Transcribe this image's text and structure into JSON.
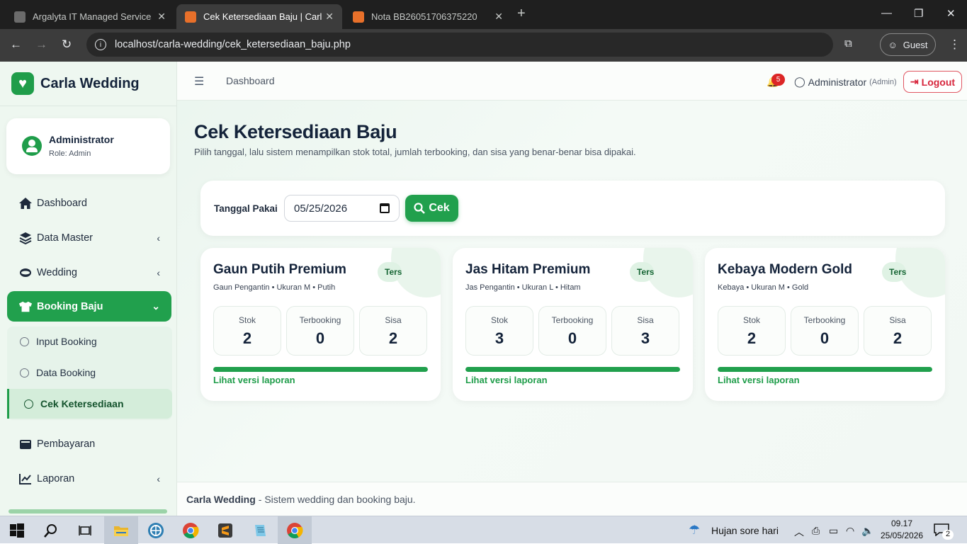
{
  "browser": {
    "tabs": [
      {
        "title": "Argalyta IT Managed Services &",
        "fav": "#5f6368"
      },
      {
        "title": "Cek Ketersediaan Baju | Carla W",
        "fav": "#e8702a"
      },
      {
        "title": "Nota BB26051706375220",
        "fav": "#e8702a"
      }
    ],
    "url": "localhost/carla-wedding/cek_ketersediaan_baju.php",
    "guest_label": "Guest"
  },
  "sidebar": {
    "brand": "Carla Wedding",
    "user_name": "Administrator",
    "user_role": "Role: Admin",
    "items": [
      {
        "label": "Dashboard",
        "icon": "home-icon"
      },
      {
        "label": "Data Master",
        "icon": "layers-icon"
      },
      {
        "label": "Wedding",
        "icon": "ring-icon"
      },
      {
        "label": "Booking Baju",
        "icon": "shirt-icon"
      },
      {
        "label": "Pembayaran",
        "icon": "wallet-icon"
      },
      {
        "label": "Laporan",
        "icon": "chart-line-icon"
      }
    ],
    "sub_items": [
      "Input Booking",
      "Data Booking",
      "Cek Ketersediaan"
    ]
  },
  "topbar": {
    "breadcrumb": "Dashboard",
    "notif_count": "5",
    "admin_name": "Administrator",
    "admin_role": "(Admin)",
    "logout_label": "Logout"
  },
  "page": {
    "title": "Cek Ketersediaan Baju",
    "subtitle": "Pilih tanggal, lalu sistem menampilkan stok total, jumlah terbooking, dan sisa yang benar-benar bisa dipakai."
  },
  "filter": {
    "label": "Tanggal Pakai",
    "date_value": "05/25/2026",
    "button_label": "Cek"
  },
  "cards": [
    {
      "title": "Gaun Putih Premium",
      "tag": "Tersedia",
      "meta": "Gaun Pengantin • Ukuran M • Putih",
      "stok": "2",
      "terbooking": "0",
      "sisa": "2",
      "availability": 1.0,
      "link": "Lihat versi laporan"
    },
    {
      "title": "Jas Hitam Premium",
      "tag": "Tersedia",
      "meta": "Jas Pengantin • Ukuran L • Hitam",
      "stok": "3",
      "terbooking": "0",
      "sisa": "3",
      "availability": 1.0,
      "link": "Lihat versi laporan"
    },
    {
      "title": "Kebaya Modern Gold",
      "tag": "Tersedia",
      "meta": "Kebaya • Ukuran M • Gold",
      "stok": "2",
      "terbooking": "0",
      "sisa": "2",
      "availability": 1.0,
      "link": "Lihat versi laporan"
    }
  ],
  "stat_labels": {
    "stok": "Stok",
    "terbooking": "Terbooking",
    "sisa": "Sisa"
  },
  "footer": {
    "brand": "Carla Wedding",
    "text": "- Sistem wedding dan booking baju."
  },
  "taskbar": {
    "weather": "Hujan sore hari",
    "time": "09.17",
    "date": "25/05/2026",
    "notif": "2"
  },
  "colors": {
    "accent": "#21a04d",
    "danger": "#dc2626"
  }
}
